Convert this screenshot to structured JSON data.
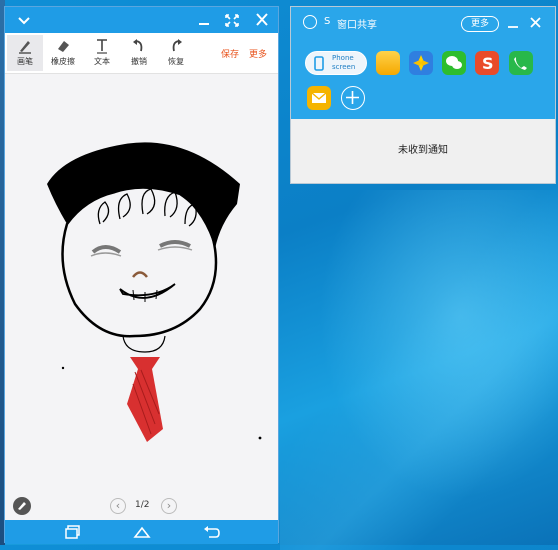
{
  "drawing_window": {
    "title_buttons": [
      "collapse",
      "minimize",
      "fullscreen",
      "close"
    ],
    "tools": [
      {
        "label": "画笔",
        "icon": "pen-icon"
      },
      {
        "label": "橡皮擦",
        "icon": "eraser-icon"
      },
      {
        "label": "文本",
        "icon": "text-icon"
      },
      {
        "label": "撤销",
        "icon": "undo-icon"
      },
      {
        "label": "恢复",
        "icon": "redo-icon"
      }
    ],
    "save_label": "保存",
    "more_label": "更多",
    "page_indicator": "1/2"
  },
  "share_window": {
    "logo_letter": "S",
    "title": "窗口共享",
    "more_label": "更多",
    "phone_screen_label_1": "Phone",
    "phone_screen_label_2": "screen",
    "notice": "未收到通知"
  },
  "colors": {
    "accent": "#1f9ce6",
    "link_orange": "#e8531c",
    "tie_red": "#d83030"
  }
}
